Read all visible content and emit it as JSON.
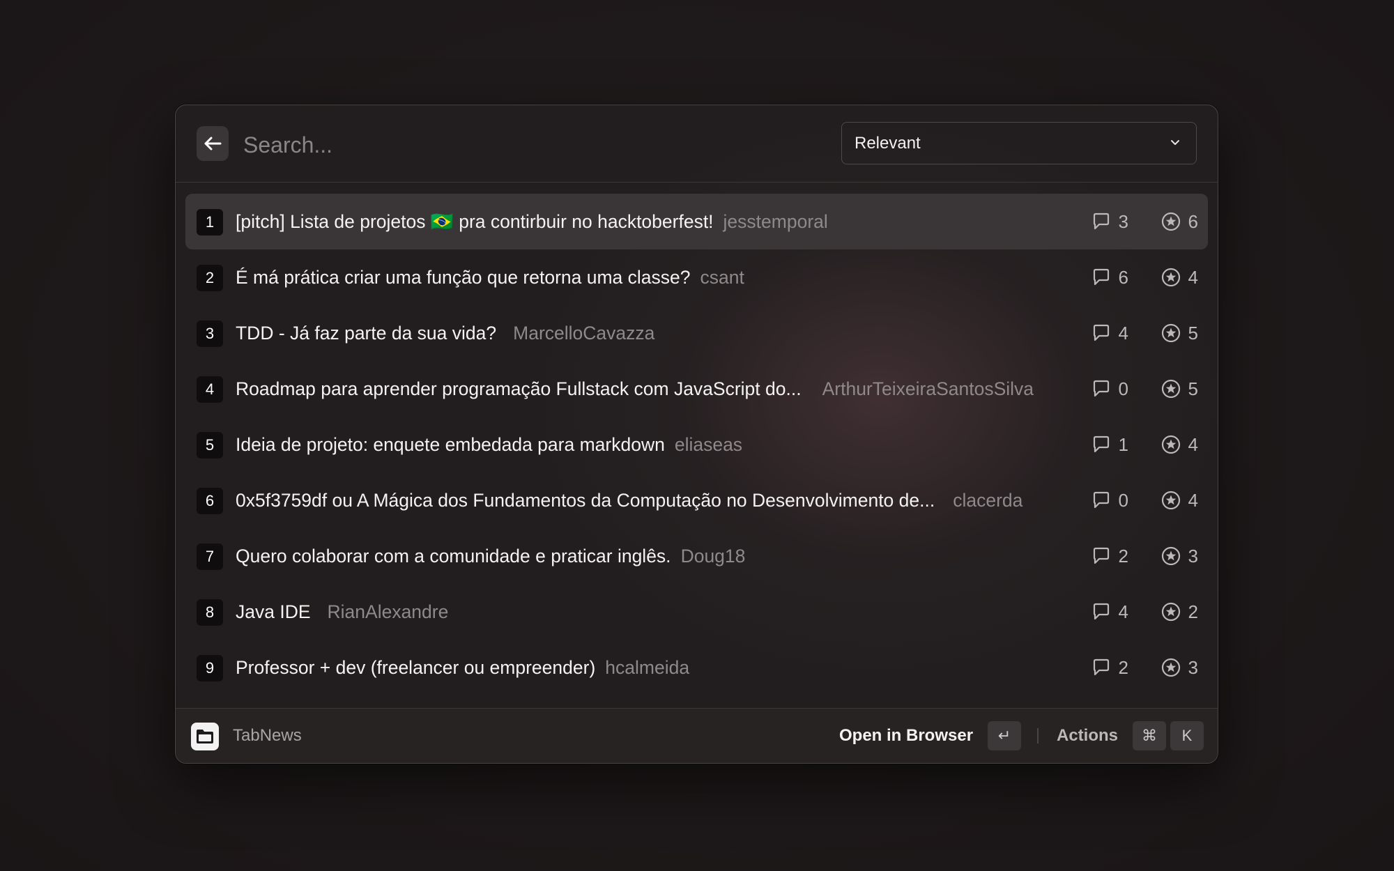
{
  "search": {
    "placeholder": "Search..."
  },
  "filter": {
    "selected": "Relevant"
  },
  "items": [
    {
      "index": "1",
      "title": "[pitch] Lista de projetos 🇧🇷 pra contirbuir no hacktoberfest!",
      "author": "jesstemporal",
      "comments": "3",
      "stars": "6"
    },
    {
      "index": "2",
      "title": "É má prática criar uma função que retorna uma classe?",
      "author": "csant",
      "comments": "6",
      "stars": "4"
    },
    {
      "index": "3",
      "title": "TDD - Já faz parte da sua vida?",
      "author": "MarcelloCavazza",
      "comments": "4",
      "stars": "5"
    },
    {
      "index": "4",
      "title": "Roadmap para aprender programação Fullstack com JavaScript do...",
      "author": "ArthurTeixeiraSantosSilva",
      "comments": "0",
      "stars": "5"
    },
    {
      "index": "5",
      "title": "Ideia de projeto: enquete embedada para markdown",
      "author": "eliaseas",
      "comments": "1",
      "stars": "4"
    },
    {
      "index": "6",
      "title": "0x5f3759df ou A Mágica dos Fundamentos da Computação no Desenvolvimento de...",
      "author": "clacerda",
      "comments": "0",
      "stars": "4"
    },
    {
      "index": "7",
      "title": "Quero colaborar com a comunidade e praticar inglês.",
      "author": "Doug18",
      "comments": "2",
      "stars": "3"
    },
    {
      "index": "8",
      "title": "Java IDE",
      "author": "RianAlexandre",
      "comments": "4",
      "stars": "2"
    },
    {
      "index": "9",
      "title": "Professor + dev (freelancer ou empreender)",
      "author": "hcalmeida",
      "comments": "2",
      "stars": "3"
    }
  ],
  "footer": {
    "app_name": "TabNews",
    "primary_action": "Open in Browser",
    "primary_key": "↵",
    "actions_label": "Actions",
    "actions_keys": [
      "⌘",
      "K"
    ]
  }
}
